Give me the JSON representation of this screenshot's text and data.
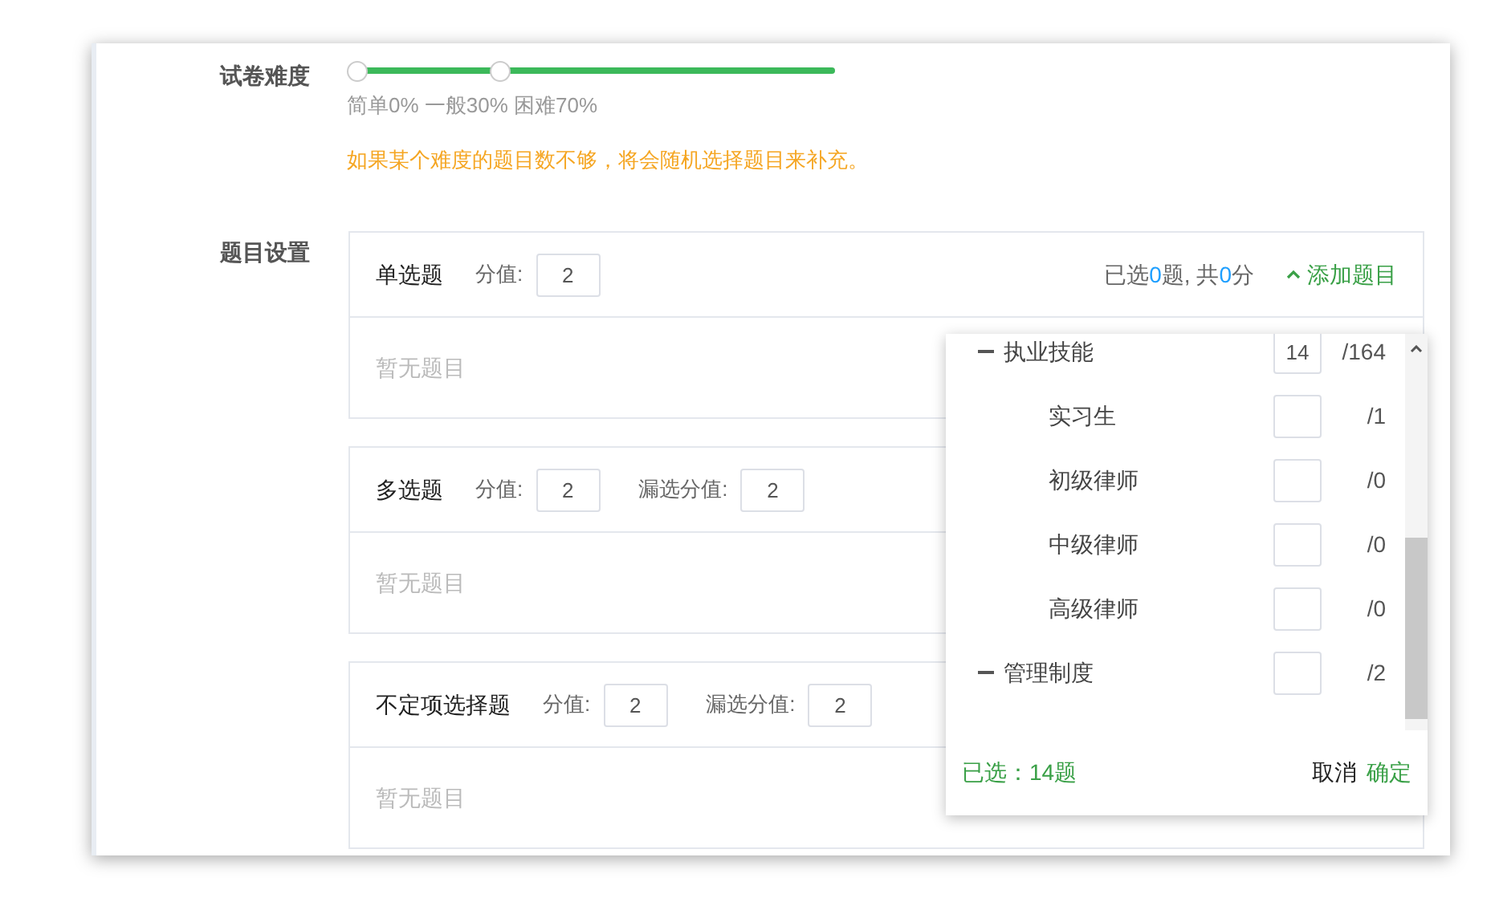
{
  "difficulty": {
    "label": "试卷难度",
    "thumbs": [
      {
        "level": 0
      },
      {
        "level": 0.3
      }
    ],
    "summary": "简单0% 一般30% 困难70%",
    "note": "如果某个难度的题目数不够，将会随机选择题目来补充。"
  },
  "questions": {
    "label": "题目设置",
    "sections": [
      {
        "title": "单选题",
        "score_label": "分值:",
        "score": "2",
        "summary": {
          "prefix": "已选",
          "count": "0",
          "mid": "题, 共",
          "points": "0",
          "suffix": "分"
        },
        "add_label": "添加题目",
        "empty": "暂无题目"
      },
      {
        "title": "多选题",
        "score_label": "分值:",
        "score": "2",
        "partial_label": "漏选分值:",
        "partial_score": "2",
        "empty": "暂无题目"
      },
      {
        "title": "不定项选择题",
        "score_label": "分值:",
        "score": "2",
        "partial_label": "漏选分值:",
        "partial_score": "2",
        "empty": "暂无题目"
      }
    ]
  },
  "picker": {
    "tree": [
      {
        "label": "执业技能",
        "value": "14",
        "total": "/164",
        "expanded": true,
        "children": [
          {
            "label": "实习生",
            "total": "/1"
          },
          {
            "label": "初级律师",
            "total": "/0"
          },
          {
            "label": "中级律师",
            "total": "/0"
          },
          {
            "label": "高级律师",
            "total": "/0"
          }
        ]
      },
      {
        "label": "管理制度",
        "total": "/2",
        "expanded": true
      }
    ],
    "selected_text": "已选：14题",
    "cancel": "取消",
    "confirm": "确定"
  }
}
